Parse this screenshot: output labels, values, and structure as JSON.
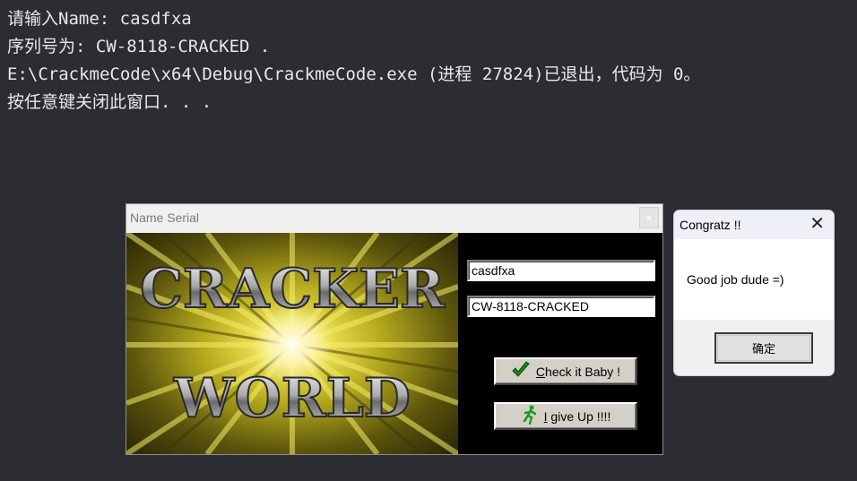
{
  "console": {
    "lines": [
      "请输入Name: casdfxa",
      "序列号为: CW-8118-CRACKED .",
      "E:\\CrackmeCode\\x64\\Debug\\CrackmeCode.exe (进程 27824)已退出，代码为 0。",
      "按任意键关闭此窗口. . ."
    ]
  },
  "dialog": {
    "title": "Name Serial",
    "close_label": "×",
    "banner_top": "CRACKER",
    "banner_bottom": "WORLD",
    "name_value": "casdfxa",
    "serial_value": "CW-8118-CRACKED",
    "check_button": "Check it Baby !",
    "giveup_button": "I give Up !!!!",
    "check_icon": "checkmark-icon",
    "giveup_icon": "running-man-icon"
  },
  "message_box": {
    "title": "Congratz !!",
    "close_label": "✕",
    "text": "Good job dude =)",
    "ok_button": "确定"
  }
}
